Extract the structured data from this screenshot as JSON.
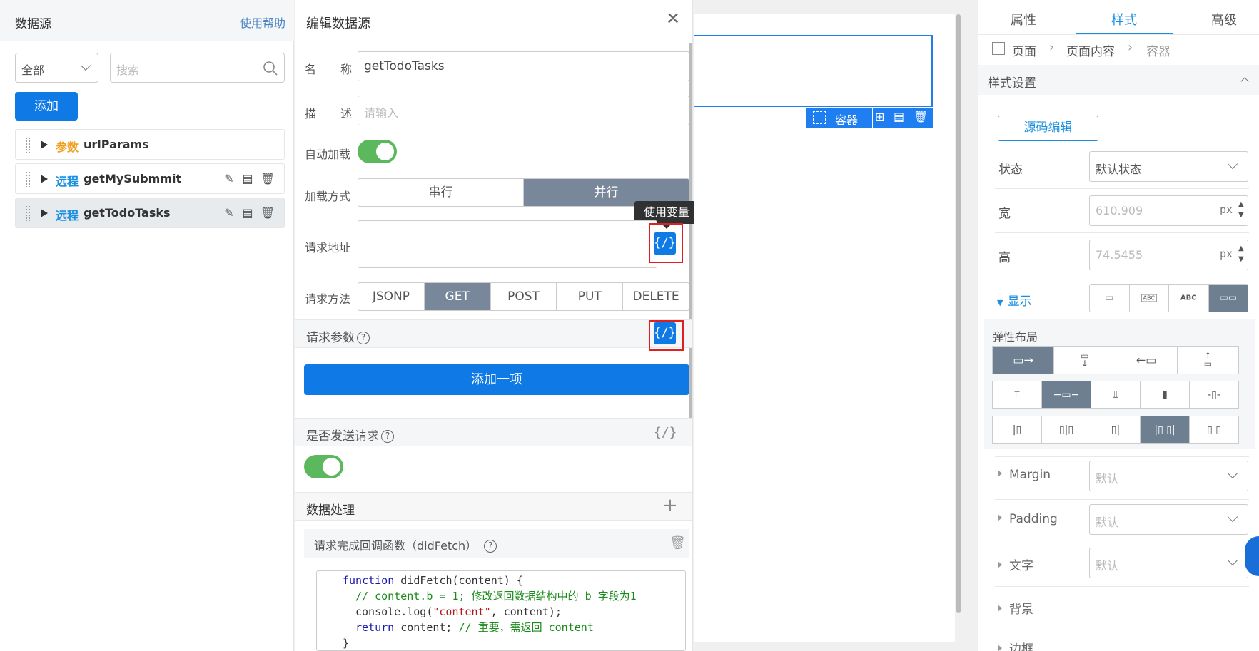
{
  "left": {
    "title": "数据源",
    "help": "使用帮助",
    "filter_value": "全部",
    "search_placeholder": "搜索",
    "add_label": "添加",
    "items": [
      {
        "kind": "参数",
        "name": "urlParams",
        "kind_color": "#f0a020"
      },
      {
        "kind": "远程",
        "name": "getMySubmmit",
        "kind_color": "#1a8fe0"
      },
      {
        "kind": "远程",
        "name": "getTodoTasks",
        "kind_color": "#1a8fe0"
      }
    ]
  },
  "edit": {
    "title": "编辑数据源",
    "name_label_1": "名",
    "name_label_2": "称",
    "name_value": "getTodoTasks",
    "desc_label_1": "描",
    "desc_label_2": "述",
    "desc_placeholder": "请输入",
    "autoload_label": "自动加载",
    "load_mode_label": "加载方式",
    "load_modes": [
      "串行",
      "并行"
    ],
    "url_label": "请求地址",
    "tooltip": "使用变量",
    "var_glyph": "{/}",
    "method_label": "请求方法",
    "methods": [
      "JSONP",
      "GET",
      "POST",
      "PUT",
      "DELETE"
    ],
    "params_label": "请求参数",
    "add_item_label": "添加一项",
    "send_label": "是否发送请求",
    "data_proc_label": "数据处理",
    "plus": "+",
    "callback_label": "请求完成回调函数（didFetch）",
    "qmark": "?",
    "code": {
      "l1_kw": "function",
      "l1_rest": " didFetch(content) {",
      "l2": "// content.b = 1; 修改返回数据结构中的 b 字段为1",
      "l3_a": "console.log(",
      "l3_str": "\"content\"",
      "l3_b": ", content);",
      "l4_kw": "return",
      "l4_rest": " content; ",
      "l4_cm": "// 重要，需返回 content",
      "l5": "}"
    }
  },
  "canvas": {
    "container_label": "容器"
  },
  "right": {
    "tabs": [
      "属性",
      "样式",
      "高级"
    ],
    "breadcrumb": [
      "页面",
      "页面内容",
      "容器"
    ],
    "section_title": "样式设置",
    "source_edit": "源码编辑",
    "state_label": "状态",
    "state_value": "默认状态",
    "width_label": "宽",
    "width_value": "610.909",
    "height_label": "高",
    "height_value": "74.5455",
    "unit": "px",
    "display_label": "显示",
    "display_glyphs": [
      "▭",
      "ABC",
      "ABC",
      "▭▭"
    ],
    "flex_label": "弹性布局",
    "margin_label": "Margin",
    "padding_label": "Padding",
    "text_label": "文字",
    "bg_label": "背景",
    "border_label": "边框",
    "default": "默认"
  }
}
